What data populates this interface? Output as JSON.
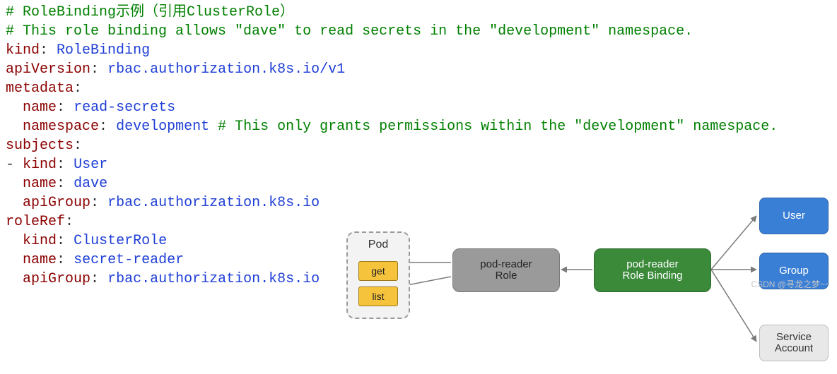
{
  "code": {
    "l1": "# RoleBinding示例（引用ClusterRole）",
    "l2": "# This role binding allows \"dave\" to read secrets in the \"development\" namespace.",
    "l3k": "kind",
    "l3v": "RoleBinding",
    "l4k": "apiVersion",
    "l4v": "rbac.authorization.k8s.io/v1",
    "l5k": "metadata",
    "l6k": "name",
    "l6v": "read-secrets",
    "l7k": "namespace",
    "l7v": "development",
    "l7c": "# This only grants permissions within the \"development\" namespace.",
    "l8k": "subjects",
    "l9k": "kind",
    "l9v": "User",
    "l10k": "name",
    "l10v": "dave",
    "l11k": "apiGroup",
    "l11v": "rbac.authorization.k8s.io",
    "l12k": "roleRef",
    "l13k": "kind",
    "l13v": "ClusterRole",
    "l14k": "name",
    "l14v": "secret-reader",
    "l15k": "apiGroup",
    "l15v": "rbac.authorization.k8s.io"
  },
  "diagram": {
    "pod": "Pod",
    "verbs": [
      "get",
      "list"
    ],
    "role": {
      "line1": "pod-reader",
      "line2": "Role"
    },
    "binding": {
      "line1": "pod-reader",
      "line2": "Role Binding"
    },
    "right": {
      "user": "User",
      "group": "Group",
      "service1": "Service",
      "service2": "Account"
    }
  },
  "watermark": "CSDN @寻龙之梦~~"
}
